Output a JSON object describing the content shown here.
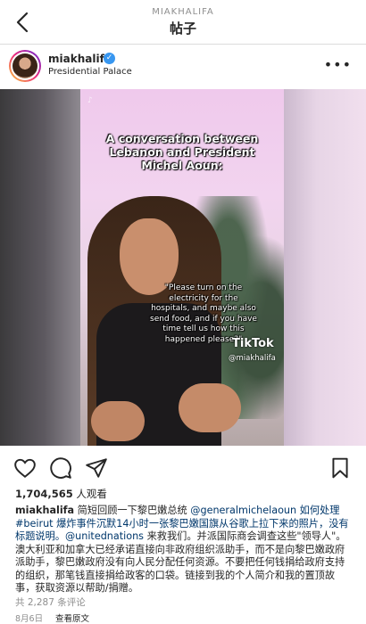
{
  "nav": {
    "username": "MIAKHALIFA",
    "title": "帖子"
  },
  "post": {
    "username": "miakhalifa",
    "verified": true,
    "location": "Presidential Palace",
    "views_count": "1,704,565",
    "views_suffix": "人观看",
    "comments": "共 2,287 条评论",
    "date": "8月6日",
    "translate": "查看原文"
  },
  "media": {
    "overlay_title": "A conversation between Lebanon and President Michel Aoun:",
    "quote": "\"Please turn on the electricity for the hospitals, and maybe also send food, and if you have time tell us how this happened please?\"",
    "tiktok_logo": "TikTok",
    "tiktok_handle": "@miakhalifa"
  },
  "caption": {
    "username": "miakhalifa",
    "segments": [
      {
        "type": "text",
        "text": " 简短回顾一下黎巴嫩总统 "
      },
      {
        "type": "text",
        "text": "@generalmichelaoun 如何处理 "
      },
      {
        "type": "link",
        "text": "#beirut"
      },
      {
        "type": "text",
        "text": " 爆炸事件沉默14小时一张黎巴嫩国旗从谷歌上拉下来的照片，没有标题说明。"
      },
      {
        "type": "link",
        "text": "@unitednations"
      },
      {
        "type": "text",
        "text": " 来救我们。并派国际商会调查这些\"领导人\"。澳大利亚和加拿大已经承诺直接向非政府组织派助手，而不是向黎巴嫩政府派助手，黎巴嫩政府没有向人民分配任何资源。不要把任何钱捐给政府支持的组织，那笔钱直接捐给政客的口袋。链接到我的个人简介和我的置顶故事，获取资源以帮助/捐赠。"
      }
    ]
  },
  "icons": [
    "back-arrow-icon",
    "verified-badge-icon",
    "more-options-icon",
    "heart-icon",
    "comment-icon",
    "share-icon",
    "bookmark-icon"
  ],
  "colors": {
    "link": "#00376b",
    "verified": "#3897f0",
    "muted": "#8e8e8e"
  }
}
